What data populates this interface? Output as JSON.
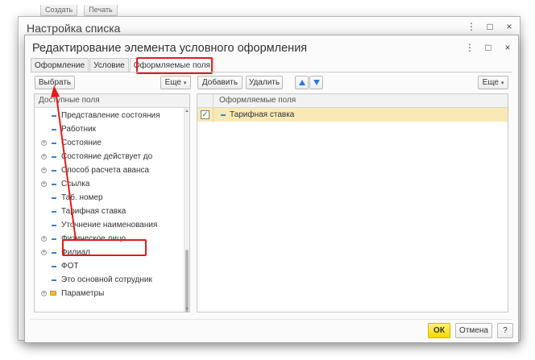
{
  "background": {
    "toolbar_items": [
      "Создать",
      "Печать"
    ]
  },
  "outer_window": {
    "title": "Настройка списка",
    "controls": [
      "⋮",
      "□",
      "×"
    ]
  },
  "dialog": {
    "title": "Редактирование элемента условного оформления",
    "controls": [
      "⋮",
      "□",
      "×"
    ],
    "tabs": [
      {
        "label": "Оформление",
        "active": false
      },
      {
        "label": "Условие",
        "active": false
      },
      {
        "label": "Оформляемые поля",
        "active": true
      }
    ]
  },
  "left_toolbar": {
    "select_label": "Выбрать",
    "more_label": "Еще",
    "more_caret": "▾"
  },
  "right_toolbar": {
    "add_label": "Добавить",
    "delete_label": "Удалить",
    "more_label": "Еще",
    "more_caret": "▾"
  },
  "available_fields": {
    "header": "Доступные поля",
    "items": [
      {
        "label": "Представление состояния",
        "expandable": false,
        "icon": "field-dash-icon"
      },
      {
        "label": "Работник",
        "expandable": false,
        "icon": "field-dash-icon"
      },
      {
        "label": "Состояние",
        "expandable": true,
        "icon": "field-dash-icon"
      },
      {
        "label": "Состояние действует до",
        "expandable": true,
        "icon": "field-dash-icon"
      },
      {
        "label": "Способ расчета аванса",
        "expandable": true,
        "icon": "field-dash-icon"
      },
      {
        "label": "Ссылка",
        "expandable": true,
        "icon": "field-dash-icon"
      },
      {
        "label": "Таб. номер",
        "expandable": false,
        "icon": "field-dash-icon"
      },
      {
        "label": "Тарифная ставка",
        "expandable": false,
        "icon": "field-dash-icon"
      },
      {
        "label": "Уточнение наименования",
        "expandable": false,
        "icon": "field-dash-icon"
      },
      {
        "label": "Физическое лицо",
        "expandable": true,
        "icon": "field-dash-icon"
      },
      {
        "label": "Филиал",
        "expandable": true,
        "icon": "field-dash-icon"
      },
      {
        "label": "ФОТ",
        "expandable": false,
        "icon": "field-dash-icon"
      },
      {
        "label": "Это основной сотрудник",
        "expandable": false,
        "icon": "field-dash-icon"
      },
      {
        "label": "Параметры",
        "expandable": true,
        "icon": "folder-icon"
      }
    ]
  },
  "formatted_fields": {
    "header": "Оформляемые поля",
    "items": [
      {
        "label": "Тарифная ставка",
        "checked": true,
        "check_glyph": "✓"
      }
    ]
  },
  "footer": {
    "ok_label": "ОК",
    "cancel_label": "Отмена",
    "help_label": "?"
  },
  "colors": {
    "highlight_red": "#e11c1c",
    "selected_row": "#f9e9b5",
    "ok_yellow": "#f5d800",
    "arrow_blue": "#2a7bd8"
  }
}
